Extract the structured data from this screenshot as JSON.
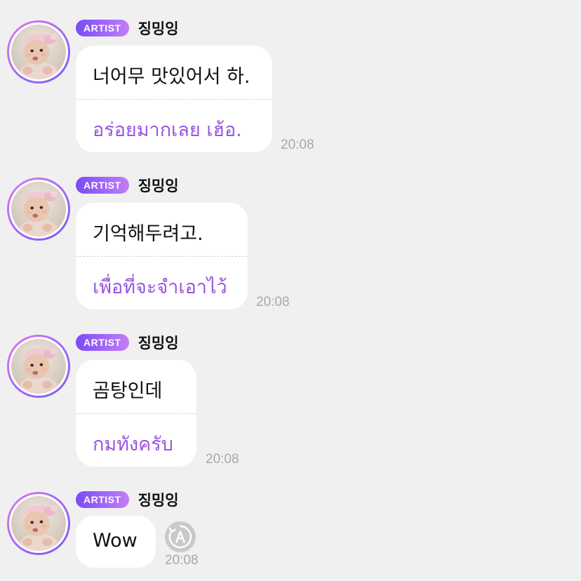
{
  "badge_label": "ARTIST",
  "sender_name": "징밍잉",
  "colors": {
    "background": "#f0f0f0",
    "bubble": "#ffffff",
    "translation_text": "#9a55e0",
    "badge_gradient_start": "#7a4cf7",
    "badge_gradient_end": "#c27ef8",
    "timestamp": "#a8a8a8"
  },
  "messages": [
    {
      "original": "너어무 맛있어서 하.",
      "translation": "อร่อยมากเลย เฮ้อ.",
      "time": "20:08"
    },
    {
      "original": "기억해두려고.",
      "translation": "เพื่อที่จะจำเอาไว้",
      "time": "20:08"
    },
    {
      "original": "곰탕인데",
      "translation": "กมทังครับ",
      "time": "20:08"
    },
    {
      "original": "Wow",
      "time": "20:08",
      "action_icon": "translate-icon"
    }
  ]
}
